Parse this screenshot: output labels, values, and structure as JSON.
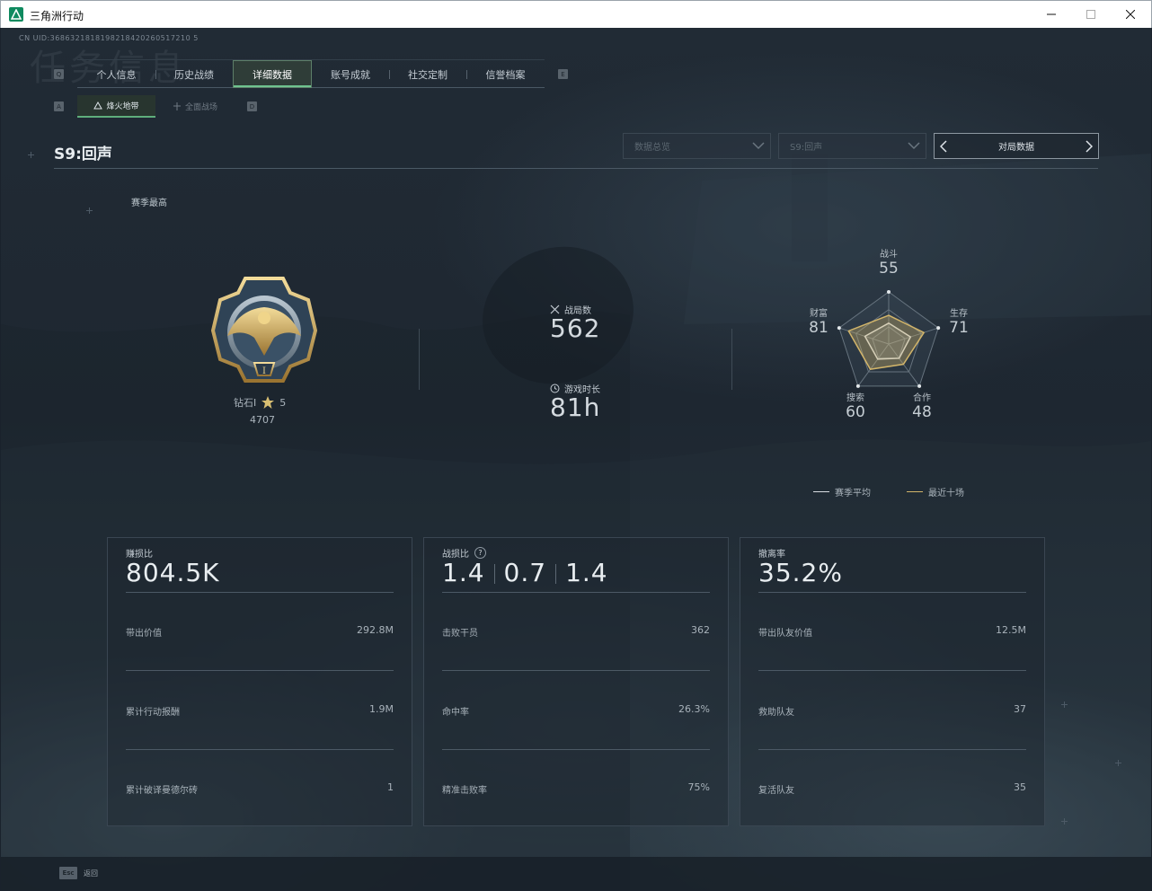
{
  "window": {
    "title": "三角洲行动",
    "controls": [
      "minimize-icon",
      "maximize-icon",
      "close-icon"
    ]
  },
  "header": {
    "uid": "CN UID:3686321818198218420260517210 5",
    "ghost_title": "任务信息"
  },
  "tabs": {
    "left_key": "Q",
    "right_key": "E",
    "items": [
      {
        "label": "个人信息",
        "active": false
      },
      {
        "label": "历史战绩",
        "active": false
      },
      {
        "label": "详细数据",
        "active": true
      },
      {
        "label": "账号成就",
        "active": false
      },
      {
        "label": "社交定制",
        "active": false
      },
      {
        "label": "信誉档案",
        "active": false
      }
    ]
  },
  "subtabs": {
    "left_key": "A",
    "right_key": "D",
    "items": [
      {
        "label": "烽火地带",
        "active": true
      },
      {
        "label": "全面战场",
        "active": false
      }
    ]
  },
  "season": {
    "title": "S9:回声",
    "best_label": "赛季最高"
  },
  "filters": {
    "data_select": "数据总览",
    "season_select": "S9:回声",
    "nav_label": "对局数据"
  },
  "rank": {
    "name": "钻石I",
    "stars": "5",
    "points": "4707"
  },
  "stats": {
    "matches_label": "战局数",
    "matches_value": "562",
    "time_label": "游戏时长",
    "time_value": "81h"
  },
  "radar": {
    "axes": [
      {
        "label": "战斗",
        "value": "55"
      },
      {
        "label": "生存",
        "value": "71"
      },
      {
        "label": "合作",
        "value": "48"
      },
      {
        "label": "搜索",
        "value": "60"
      },
      {
        "label": "财富",
        "value": "81"
      }
    ],
    "season_avg": [
      40,
      44,
      34,
      36,
      48
    ],
    "recent_ten": [
      55,
      71,
      48,
      60,
      81
    ],
    "legend": [
      {
        "label": "赛季平均",
        "color": "#d9dee2"
      },
      {
        "label": "最近十场",
        "color": "#d2b56a"
      }
    ]
  },
  "panels": [
    {
      "title": "赚损比",
      "big": [
        "804.5K"
      ],
      "help": false,
      "rows": [
        {
          "label": "带出价值",
          "value": "292.8M"
        },
        {
          "label": "累计行动报酬",
          "value": "1.9M"
        },
        {
          "label": "累计破译曼德尔砖",
          "value": "1"
        }
      ]
    },
    {
      "title": "战损比",
      "big": [
        "1.4",
        "0.7",
        "1.4"
      ],
      "help": true,
      "rows": [
        {
          "label": "击败干员",
          "value": "362"
        },
        {
          "label": "命中率",
          "value": "26.3%"
        },
        {
          "label": "精准击败率",
          "value": "75%"
        }
      ]
    },
    {
      "title": "撤离率",
      "big": [
        "35.2%"
      ],
      "help": false,
      "rows": [
        {
          "label": "带出队友价值",
          "value": "12.5M"
        },
        {
          "label": "救助队友",
          "value": "37"
        },
        {
          "label": "复活队友",
          "value": "35"
        }
      ]
    }
  ],
  "footer": {
    "esc_key": "Esc",
    "esc_label": "返回"
  },
  "colors": {
    "accent_green": "#6fc48f",
    "radar_gold": "#d2b56a",
    "radar_white": "#d9dee2"
  }
}
